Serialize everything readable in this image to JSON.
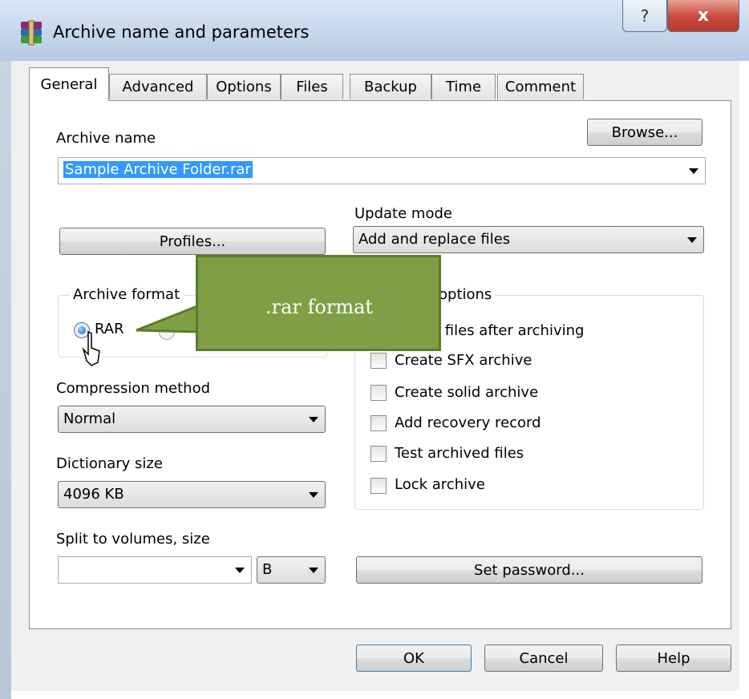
{
  "window": {
    "title": "Archive name and parameters",
    "help_glyph": "?",
    "close_glyph": "x"
  },
  "tabs": [
    {
      "label": "General",
      "active": true
    },
    {
      "label": "Advanced"
    },
    {
      "label": "Options"
    },
    {
      "label": "Files"
    },
    {
      "label": "Backup"
    },
    {
      "label": "Time"
    },
    {
      "label": "Comment"
    }
  ],
  "general": {
    "archive_name_label": "Archive name",
    "browse_label": "Browse...",
    "archive_name_value": "Sample Archive Folder.rar",
    "profiles_label": "Profiles...",
    "update_mode_label": "Update mode",
    "update_mode_value": "Add and replace files",
    "archive_format_label": "Archive format",
    "format_rar_label": "RAR",
    "archiving_options_label": "options",
    "compression_method_label": "Compression method",
    "compression_method_value": "Normal",
    "dictionary_size_label": "Dictionary size",
    "dictionary_size_value": "4096 KB",
    "split_volumes_label": "Split to volumes, size",
    "split_volumes_value": "",
    "split_unit_value": "B",
    "set_password_label": "Set password...",
    "options": [
      {
        "label": "e files after archiving",
        "checked": false
      },
      {
        "label": "Create SFX archive",
        "checked": false
      },
      {
        "label": "Create solid archive",
        "checked": false
      },
      {
        "label": "Add recovery record",
        "checked": false
      },
      {
        "label": "Test archived files",
        "checked": false
      },
      {
        "label": "Lock archive",
        "checked": false
      }
    ]
  },
  "buttons": {
    "ok": "OK",
    "cancel": "Cancel",
    "help": "Help"
  },
  "callout": {
    "text": ".rar format",
    "color": "#7f9f45"
  },
  "colors": {
    "selection": "#3399ff",
    "close_button": "#c8483a"
  }
}
